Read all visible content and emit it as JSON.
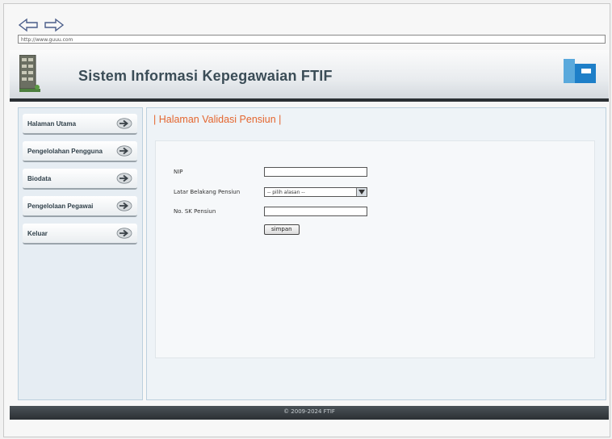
{
  "browser": {
    "url": "http://www.guuu.com"
  },
  "header": {
    "title": "Sistem Informasi Kepegawaian FTIF"
  },
  "sidebar": {
    "items": [
      {
        "label": "Halaman Utama"
      },
      {
        "label": "Pengelolahan Pengguna"
      },
      {
        "label": "Biodata"
      },
      {
        "label": "Pengelolaan Pegawai"
      },
      {
        "label": "Keluar"
      }
    ]
  },
  "main": {
    "title": "| Halaman Validasi Pensiun |",
    "form": {
      "nip_label": "NIP",
      "nip_value": "",
      "latar_label": "Latar Belakang Pensiun",
      "latar_selected": "-- pilih alasan --",
      "sk_label": "No. SK Pensiun",
      "sk_value": "",
      "submit_label": "simpan"
    }
  },
  "footer": {
    "text": "© 2009-2024 FTIF"
  },
  "colors": {
    "accent_title": "#e4662f",
    "header_text": "#3b4d57",
    "footer_bg": "#2b3034"
  },
  "icons": [
    "back-arrow-icon",
    "forward-arrow-icon",
    "building-logo-icon",
    "brand-logo-icon",
    "arrow-right-icon"
  ]
}
